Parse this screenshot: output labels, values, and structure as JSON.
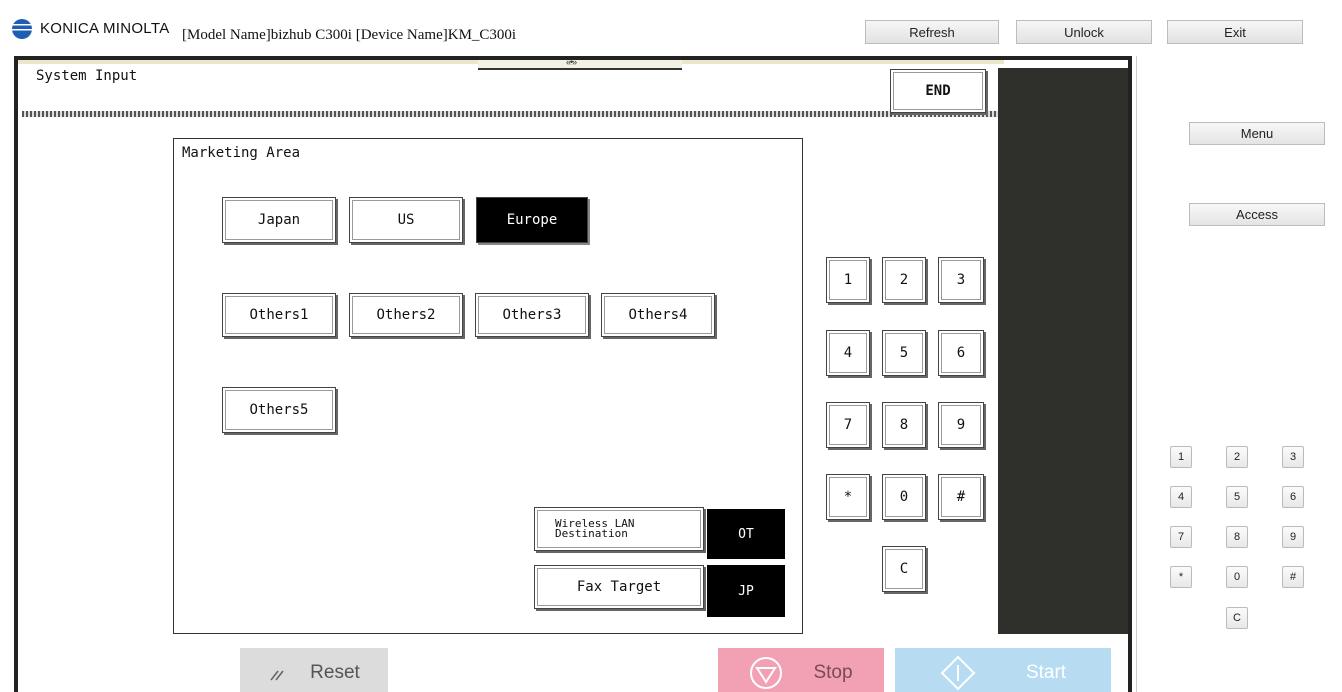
{
  "topbar": {
    "brand": "KONICA MINOLTA",
    "model_info": "[Model Name]bizhub C300i [Device Name]KM_C300i",
    "refresh": "Refresh",
    "unlock": "Unlock",
    "exit": "Exit"
  },
  "screen": {
    "title": "System Input",
    "top_strip_mark": "«•»",
    "end": "END"
  },
  "marketing": {
    "title": "Marketing Area",
    "areas": [
      "Japan",
      "US",
      "Europe",
      "Others1",
      "Others2",
      "Others3",
      "Others4",
      "Others5"
    ],
    "selected": "Europe",
    "wireless_label": "Wireless LAN Destination",
    "wireless_value": "OT",
    "fax_label": "Fax Target",
    "fax_value": "JP"
  },
  "keypad": {
    "keys": [
      "1",
      "2",
      "3",
      "4",
      "5",
      "6",
      "7",
      "8",
      "9",
      "*",
      "0",
      "#"
    ],
    "clear": "C"
  },
  "controls": {
    "reset": "Reset",
    "stop": "Stop",
    "start": "Start"
  },
  "right_panel": {
    "menu": "Menu",
    "access": "Access",
    "keys": [
      "1",
      "2",
      "3",
      "4",
      "5",
      "6",
      "7",
      "8",
      "9",
      "*",
      "0",
      "#"
    ],
    "clear": "C"
  },
  "colors": {
    "stop": "#f2a1b3",
    "start": "#b7dcf2",
    "reset": "#dcdcdc",
    "dark_panel": "#2f2f2c",
    "brand_blue": "#1e5fb3"
  }
}
